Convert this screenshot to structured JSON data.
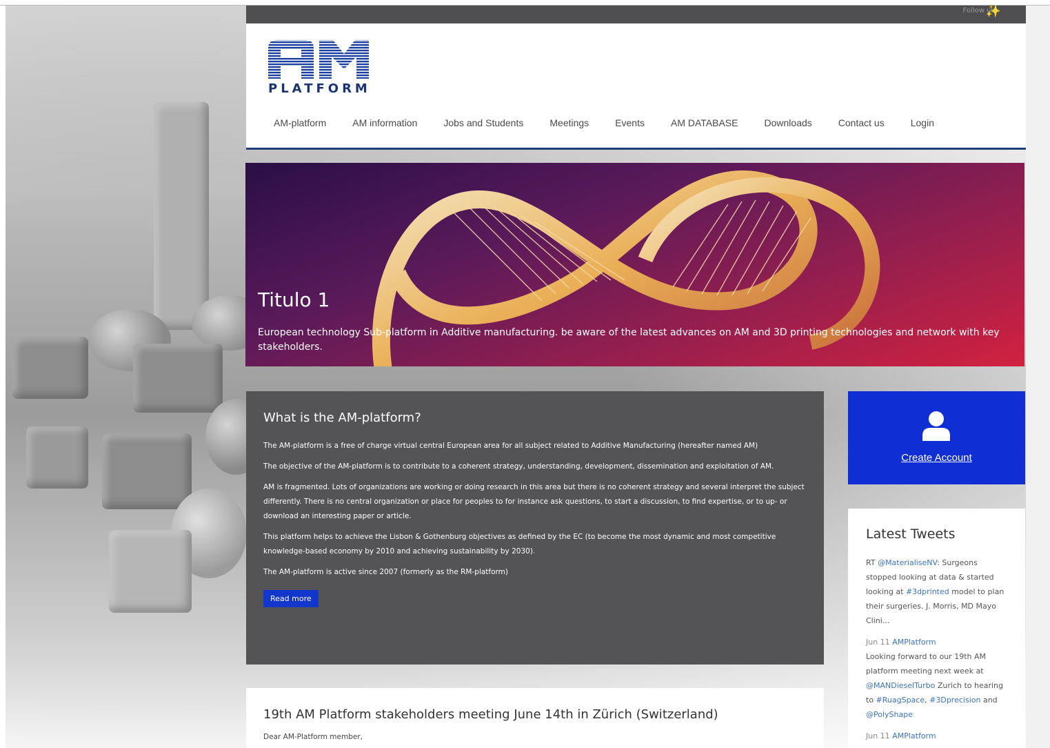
{
  "topbar": {
    "follow_label": "Follow us:",
    "social_icon": "twitter-bird-icon"
  },
  "brand": {
    "logo_big": "AM",
    "logo_small": "PLATFORM"
  },
  "nav": {
    "items": [
      {
        "label": "AM-platform"
      },
      {
        "label": "AM information"
      },
      {
        "label": "Jobs and Students"
      },
      {
        "label": "Meetings"
      },
      {
        "label": "Events"
      },
      {
        "label": "AM DATABASE"
      },
      {
        "label": "Downloads"
      },
      {
        "label": "Contact us"
      },
      {
        "label": "Login"
      }
    ]
  },
  "hero": {
    "title": "Titulo 1",
    "text": "European technology Sub-platform in Additive manufacturing. be aware of the latest advances on AM and 3D printing technologies and network with key stakeholders."
  },
  "about": {
    "title": "What is the AM-platform?",
    "paragraphs": [
      "The AM-platform is a free of charge virtual central European area for all subject related to Additive Manufacturing (hereafter named AM)",
      "The objective of the AM-platform is to contribute to a coherent strategy, understanding, development, dissemination and exploitation of AM.",
      "AM is fragmented. Lots of organizations are working or doing research in this area but there is no coherent strategy and several interpret the subject differently. There is no central organization or place for peoples to for instance ask questions, to start a discussion, to find expertise, or to up- or download an interesting paper or article.",
      "This platform helps to achieve the Lisbon & Gothenburg objectives as defined by the EC (to become the most dynamic and most competitive knowledge-based economy by 2010 and achieving sustainability by 2030).",
      "The AM-platform is active since 2007 (formerly as the RM-platform)"
    ],
    "read_more": "Read more"
  },
  "account": {
    "icon": "user-icon",
    "label": "Create Account"
  },
  "tweets": {
    "title": "Latest Tweets",
    "items": [
      {
        "date": "",
        "author": "",
        "pre": "RT ",
        "mention": "@MaterialiseNV",
        "mid": ": Surgeons stopped looking at data & started looking at ",
        "tag": "#3dprinted",
        "post": " model to plan their surgeries. J. Morris, MD Mayo Clini..."
      },
      {
        "date": "Jun 11 ",
        "author": "AMPlatform",
        "text1": "Looking forward to our 19th AM platform meeting next week at ",
        "mention": "@MANDieselTurbo",
        "text2": " Zurich to hearing to ",
        "tag1": "#RuagSpace",
        "text3": ", ",
        "tag2": "#3Dprecision",
        "text4": " and ",
        "mention2": "@PolyShape"
      },
      {
        "date": "Jun 11 ",
        "author": "AMPlatform"
      }
    ]
  },
  "news": {
    "title": "19th AM Platform stakeholders meeting June 14th in Zürich (Switzerland)",
    "greeting": "Dear AM-Platform member,"
  },
  "colors": {
    "topbar": "#4e4e50",
    "nav_underline": "#1f3f7a",
    "about_bg": "#545457",
    "account_bg": "#0f2fd4",
    "button_bg": "#1235cc",
    "link": "#3a73c0"
  }
}
